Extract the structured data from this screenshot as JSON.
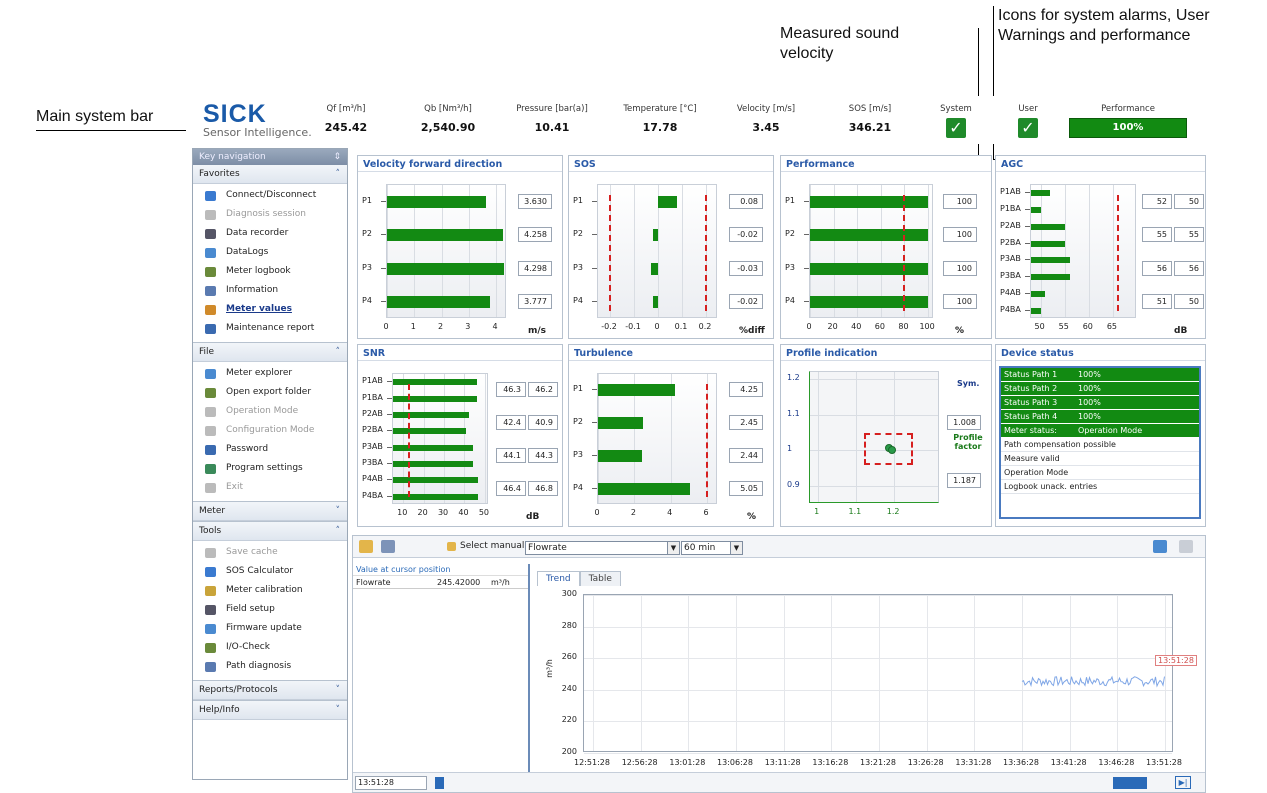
{
  "callouts": {
    "main_system_bar": "Main system bar",
    "measured_sos": "Measured sound velocity",
    "icons": "Icons for system alarms, User Warnings and performance"
  },
  "sysbar": {
    "logo": "SICK",
    "logo_sub": "Sensor Intelligence.",
    "columns": [
      {
        "label": "Qf [m³/h]",
        "value": "245.42"
      },
      {
        "label": "Qb [Nm³/h]",
        "value": "2,540.90"
      },
      {
        "label": "Pressure [bar(a)]",
        "value": "10.41"
      },
      {
        "label": "Temperature [°C]",
        "value": "17.78"
      },
      {
        "label": "Velocity [m/s]",
        "value": "3.45"
      },
      {
        "label": "SOS [m/s]",
        "value": "346.21"
      }
    ],
    "system_label": "System",
    "user_label": "User",
    "performance_label": "Performance",
    "performance_value": "100%"
  },
  "sidebar": {
    "key_navigation": "Key navigation",
    "groups": [
      {
        "title": "Favorites",
        "expanded": true,
        "items": [
          {
            "label": "Connect/Disconnect",
            "icon": "plug-icon",
            "enabled": true
          },
          {
            "label": "Diagnosis session",
            "icon": "diagnosis-icon",
            "enabled": false
          },
          {
            "label": "Data recorder",
            "icon": "recorder-icon",
            "enabled": true
          },
          {
            "label": "DataLogs",
            "icon": "datalogs-icon",
            "enabled": true
          },
          {
            "label": "Meter logbook",
            "icon": "logbook-icon",
            "enabled": true
          },
          {
            "label": "Information",
            "icon": "info-icon",
            "enabled": true
          },
          {
            "label": "Meter values",
            "icon": "meter-values-icon",
            "enabled": true,
            "selected": true
          },
          {
            "label": "Maintenance report",
            "icon": "report-icon",
            "enabled": true
          }
        ]
      },
      {
        "title": "File",
        "expanded": true,
        "items": [
          {
            "label": "Meter explorer",
            "icon": "explorer-icon",
            "enabled": true
          },
          {
            "label": "Open export folder",
            "icon": "folder-icon",
            "enabled": true
          },
          {
            "label": "Operation Mode",
            "icon": "operation-icon",
            "enabled": false
          },
          {
            "label": "Configuration Mode",
            "icon": "config-icon",
            "enabled": false
          },
          {
            "label": "Password",
            "icon": "users-icon",
            "enabled": true
          },
          {
            "label": "Program settings",
            "icon": "settings-icon",
            "enabled": true
          },
          {
            "label": "Exit",
            "icon": "exit-icon",
            "enabled": false
          }
        ]
      },
      {
        "title": "Meter",
        "expanded": false,
        "items": []
      },
      {
        "title": "Tools",
        "expanded": true,
        "items": [
          {
            "label": "Save cache",
            "icon": "cache-icon",
            "enabled": false
          },
          {
            "label": "SOS Calculator",
            "icon": "calculator-icon",
            "enabled": true
          },
          {
            "label": "Meter calibration",
            "icon": "calibration-icon",
            "enabled": true
          },
          {
            "label": "Field setup",
            "icon": "field-setup-icon",
            "enabled": true
          },
          {
            "label": "Firmware update",
            "icon": "firmware-icon",
            "enabled": true
          },
          {
            "label": "I/O-Check",
            "icon": "io-check-icon",
            "enabled": true
          },
          {
            "label": "Path diagnosis",
            "icon": "path-diagnosis-icon",
            "enabled": true
          }
        ]
      },
      {
        "title": "Reports/Protocols",
        "expanded": false,
        "items": []
      },
      {
        "title": "Help/Info",
        "expanded": false,
        "items": []
      }
    ]
  },
  "panels": {
    "velocity": {
      "title": "Velocity forward direction",
      "unit": "m/s",
      "xticks": [
        "0",
        "1",
        "2",
        "3",
        "4"
      ]
    },
    "sos": {
      "title": "SOS",
      "unit": "%diff",
      "xticks": [
        "-0.2",
        "-0.1",
        "0",
        "0.1",
        "0.2"
      ]
    },
    "performance": {
      "title": "Performance",
      "unit": "%",
      "xticks": [
        "0",
        "20",
        "40",
        "60",
        "80",
        "100"
      ]
    },
    "agc": {
      "title": "AGC",
      "unit": "dB",
      "xticks": [
        "50",
        "55",
        "60",
        "65"
      ],
      "col_ab": "AB",
      "col_ba": "BA"
    },
    "snr": {
      "title": "SNR",
      "unit": "dB",
      "xticks": [
        "10",
        "20",
        "30",
        "40",
        "50"
      ],
      "col_ab": "AB",
      "col_ba": "BA"
    },
    "turbulence": {
      "title": "Turbulence",
      "unit": "%",
      "xticks": [
        "0",
        "2",
        "4",
        "6"
      ]
    },
    "profile": {
      "title": "Profile indication",
      "sym_label": "Sym.",
      "sym_value": "1.008",
      "pf_label": "Profile factor",
      "pf_value": "1.187",
      "yticks": [
        "1.2",
        "1.1",
        "1",
        "0.9"
      ],
      "xticks": [
        "1",
        "1.1",
        "1.2"
      ]
    },
    "device_status": {
      "title": "Device status",
      "rows": [
        {
          "name": "Status Path 1",
          "value": "100%",
          "ok": true
        },
        {
          "name": "Status Path 2",
          "value": "100%",
          "ok": true
        },
        {
          "name": "Status Path 3",
          "value": "100%",
          "ok": true
        },
        {
          "name": "Status Path 4",
          "value": "100%",
          "ok": true
        },
        {
          "name": "Meter status:",
          "value": "Operation Mode",
          "ok": true
        },
        {
          "name": "Path compensation possible",
          "value": "",
          "ok": false
        },
        {
          "name": "Measure valid",
          "value": "",
          "ok": false
        },
        {
          "name": "Operation Mode",
          "value": "",
          "ok": false
        },
        {
          "name": "Logbook unack. entries",
          "value": "",
          "ok": false
        }
      ]
    }
  },
  "trend": {
    "select_manually": "Select manually",
    "quantity": "Flowrate",
    "interval": "60 min",
    "cursor_title": "Value at cursor position",
    "cursor_name": "Flowrate",
    "cursor_value": "245.42000",
    "cursor_unit": "m³/h",
    "tab_trend": "Trend",
    "tab_table": "Table",
    "ylabel": "m³/h",
    "cursor_time": "13:51:28",
    "status_time": "13:51:28"
  },
  "chart_data": [
    {
      "type": "bar",
      "title": "Velocity forward direction",
      "categories": [
        "P1",
        "P2",
        "P3",
        "P4"
      ],
      "values": [
        3.63,
        4.258,
        4.298,
        3.777
      ],
      "value_labels": [
        "3.630",
        "4.258",
        "4.298",
        "3.777"
      ],
      "xlabel": "m/s",
      "xlim": [
        0,
        4.4
      ]
    },
    {
      "type": "bar",
      "title": "SOS",
      "categories": [
        "P1",
        "P2",
        "P3",
        "P4"
      ],
      "values": [
        0.08,
        -0.02,
        -0.03,
        -0.02
      ],
      "value_labels": [
        "0.08",
        "-0.02",
        "-0.03",
        "-0.02"
      ],
      "xlabel": "%diff",
      "xlim": [
        -0.25,
        0.25
      ],
      "limits": [
        -0.2,
        0.2
      ]
    },
    {
      "type": "bar",
      "title": "Performance",
      "categories": [
        "P1",
        "P2",
        "P3",
        "P4"
      ],
      "values": [
        100,
        100,
        100,
        100
      ],
      "value_labels": [
        "100",
        "100",
        "100",
        "100"
      ],
      "xlabel": "%",
      "xlim": [
        0,
        105
      ],
      "limits": [
        80
      ]
    },
    {
      "type": "bar",
      "title": "AGC",
      "categories": [
        "P1AB",
        "P1BA",
        "P2AB",
        "P2BA",
        "P3AB",
        "P3BA",
        "P4AB",
        "P4BA"
      ],
      "values": [
        52,
        50,
        55,
        55,
        56,
        56,
        51,
        50
      ],
      "value_labels": [
        "52",
        "50",
        "55",
        "55",
        "56",
        "56",
        "51",
        "50"
      ],
      "xlabel": "dB",
      "xlim": [
        48,
        70
      ],
      "limits": [
        66
      ]
    },
    {
      "type": "bar",
      "title": "SNR",
      "categories": [
        "P1AB",
        "P1BA",
        "P2AB",
        "P2BA",
        "P3AB",
        "P3BA",
        "P4AB",
        "P4BA"
      ],
      "values": [
        46.3,
        46.2,
        42.4,
        40.9,
        44.1,
        44.3,
        46.4,
        46.8
      ],
      "value_labels": [
        "46.3",
        "46.2",
        "42.4",
        "40.9",
        "44.1",
        "44.3",
        "46.4",
        "46.8"
      ],
      "xlabel": "dB",
      "xlim": [
        5,
        52
      ],
      "limits": [
        13
      ]
    },
    {
      "type": "bar",
      "title": "Turbulence",
      "categories": [
        "P1",
        "P2",
        "P3",
        "P4"
      ],
      "values": [
        4.25,
        2.45,
        2.44,
        5.05
      ],
      "value_labels": [
        "4.25",
        "2.45",
        "2.44",
        "5.05"
      ],
      "xlabel": "%",
      "xlim": [
        0,
        6.6
      ],
      "limits": [
        6
      ]
    },
    {
      "type": "scatter",
      "title": "Profile indication",
      "x": [
        1.187,
        1.195
      ],
      "y": [
        1.008,
        1.0
      ],
      "xlim": [
        0.98,
        1.32
      ],
      "ylim": [
        0.85,
        1.22
      ]
    },
    {
      "type": "line",
      "title": "",
      "ylabel": "m³/h",
      "x": [
        "12:51:28",
        "12:56:28",
        "13:01:28",
        "13:06:28",
        "13:11:28",
        "13:16:28",
        "13:21:28",
        "13:26:28",
        "13:31:28",
        "13:36:28",
        "13:41:28",
        "13:46:28",
        "13:51:28"
      ],
      "ylim": [
        200,
        300
      ],
      "yticks": [
        "300",
        "280",
        "260",
        "240",
        "220",
        "200"
      ],
      "series": [
        {
          "values_from": "13:36:28",
          "mean": 245.4
        }
      ]
    }
  ],
  "colors": {
    "bar": "#138a13",
    "limit": "#d61f1f",
    "accent": "#2a5aa8",
    "trend_line": "#7fa6e6"
  }
}
